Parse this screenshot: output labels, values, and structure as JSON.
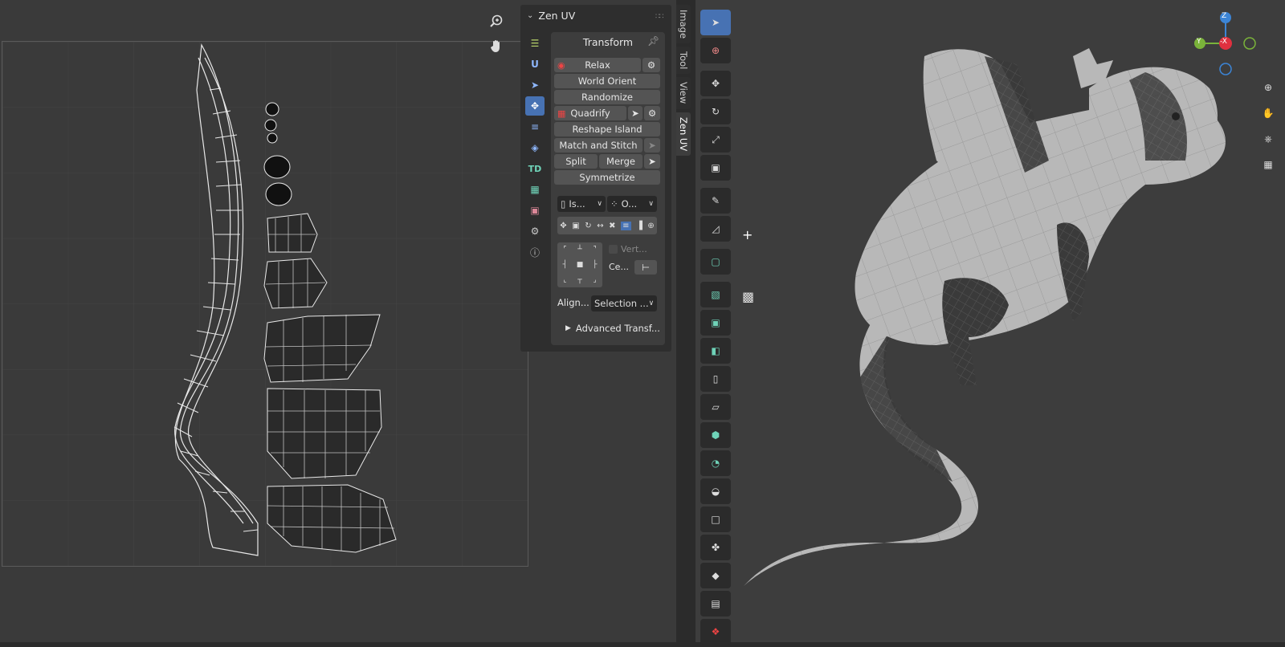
{
  "panel": {
    "title": "Zen UV",
    "subpanel_title": "Transform",
    "buttons": {
      "relax": "Relax",
      "world_orient": "World Orient",
      "randomize": "Randomize",
      "quadrify": "Quadrify",
      "reshape_island": "Reshape Island",
      "match_and_stitch": "Match and Stitch",
      "split": "Split",
      "merge": "Merge",
      "symmetrize": "Symmetrize"
    },
    "mode_select_1": "Is...",
    "mode_select_2": "O...",
    "vert_checkbox_label": "Vert...",
    "center_label": "Ce...",
    "align_label": "Align...",
    "align_select": "Selection ...",
    "advanced_label": "Advanced Transf...",
    "side_icon_td": "TD",
    "side_icon_u": "U"
  },
  "vertical_tabs": [
    "Image",
    "Tool",
    "View",
    "Zen UV"
  ],
  "gizmo": {
    "z": "Z",
    "y": "Y",
    "x": "-X"
  },
  "colors": {
    "accent": "#4772b3",
    "gizmo_x": "#e0303f",
    "gizmo_y": "#7ab33a",
    "gizmo_z": "#3c85d6"
  }
}
